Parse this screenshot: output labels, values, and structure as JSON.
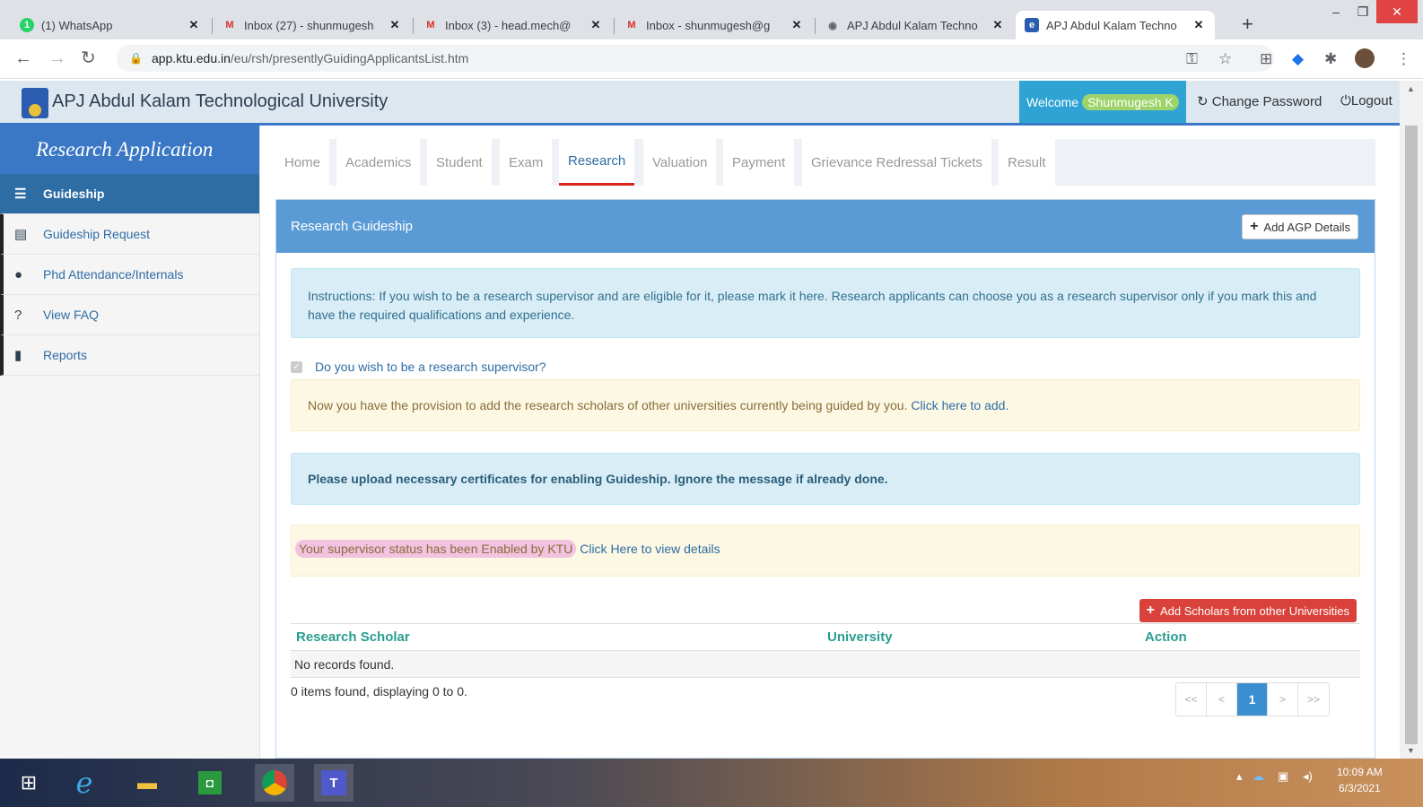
{
  "browser": {
    "tabs": [
      {
        "title": "(1) WhatsApp",
        "icon": "whatsapp-icon",
        "color": "#25d366",
        "active": false
      },
      {
        "title": "Inbox (27) - shunmugesh",
        "icon": "gmail-icon",
        "color": "#d93025",
        "active": false
      },
      {
        "title": "Inbox (3) - head.mech@",
        "icon": "gmail-icon",
        "color": "#d93025",
        "active": false
      },
      {
        "title": "Inbox - shunmugesh@g",
        "icon": "gmail-icon",
        "color": "#d93025",
        "active": false
      },
      {
        "title": "APJ Abdul Kalam Techno",
        "icon": "globe-icon",
        "color": "#5f6368",
        "active": false
      },
      {
        "title": "APJ Abdul Kalam Techno",
        "icon": "ktu-favicon",
        "color": "#2a5db0",
        "active": true
      }
    ],
    "url_domain": "app.ktu.edu.in",
    "url_path": "/eu/rsh/presentlyGuidingApplicantsList.htm"
  },
  "header": {
    "university": "APJ Abdul Kalam Technological University",
    "welcome_label": "Welcome",
    "user_name": "Shunmugesh K",
    "change_password": "Change Password",
    "logout": "Logout"
  },
  "sidebar": {
    "title": "Research Application",
    "items": [
      {
        "label": "Guideship",
        "icon": "list-icon",
        "active": true
      },
      {
        "label": "Guideship Request",
        "icon": "grid-list-icon",
        "active": false
      },
      {
        "label": "Phd Attendance/Internals",
        "icon": "user-icon",
        "active": false
      },
      {
        "label": "View FAQ",
        "icon": "question-circle-icon",
        "active": false
      },
      {
        "label": "Reports",
        "icon": "book-icon",
        "active": false
      }
    ]
  },
  "menu": [
    "Home",
    "Academics",
    "Student",
    "Exam",
    "Research",
    "Valuation",
    "Payment",
    "Grievance Redressal Tickets",
    "Result"
  ],
  "menu_active": "Research",
  "panel": {
    "title": "Research Guideship",
    "add_agp": "Add AGP Details",
    "instructions": "Instructions: If you wish to be a research supervisor and are eligible for it, please mark it here. Research applicants can choose you as a research supervisor only if you mark this and have the required qualifications and experience.",
    "checkbox_label": "Do you wish to be a research supervisor?",
    "provision_text": "Now you have the provision to add the research scholars of other universities currently being guided by you.",
    "provision_link": "Click here to add.",
    "upload_msg": "Please upload necessary certificates for enabling Guideship. Ignore the message if already done.",
    "status_text": "Your supervisor status has been Enabled by KTU",
    "status_link": "Click Here to view details",
    "add_scholars": "Add Scholars from other Universities",
    "columns": [
      "Research Scholar",
      "University",
      "Action"
    ],
    "no_records": "No records found.",
    "items_found": "0 items found, displaying 0 to 0.",
    "pager": [
      "<<",
      "<",
      "1",
      ">",
      ">>"
    ]
  },
  "taskbar": {
    "time": "10:09 AM",
    "date": "6/3/2021"
  }
}
